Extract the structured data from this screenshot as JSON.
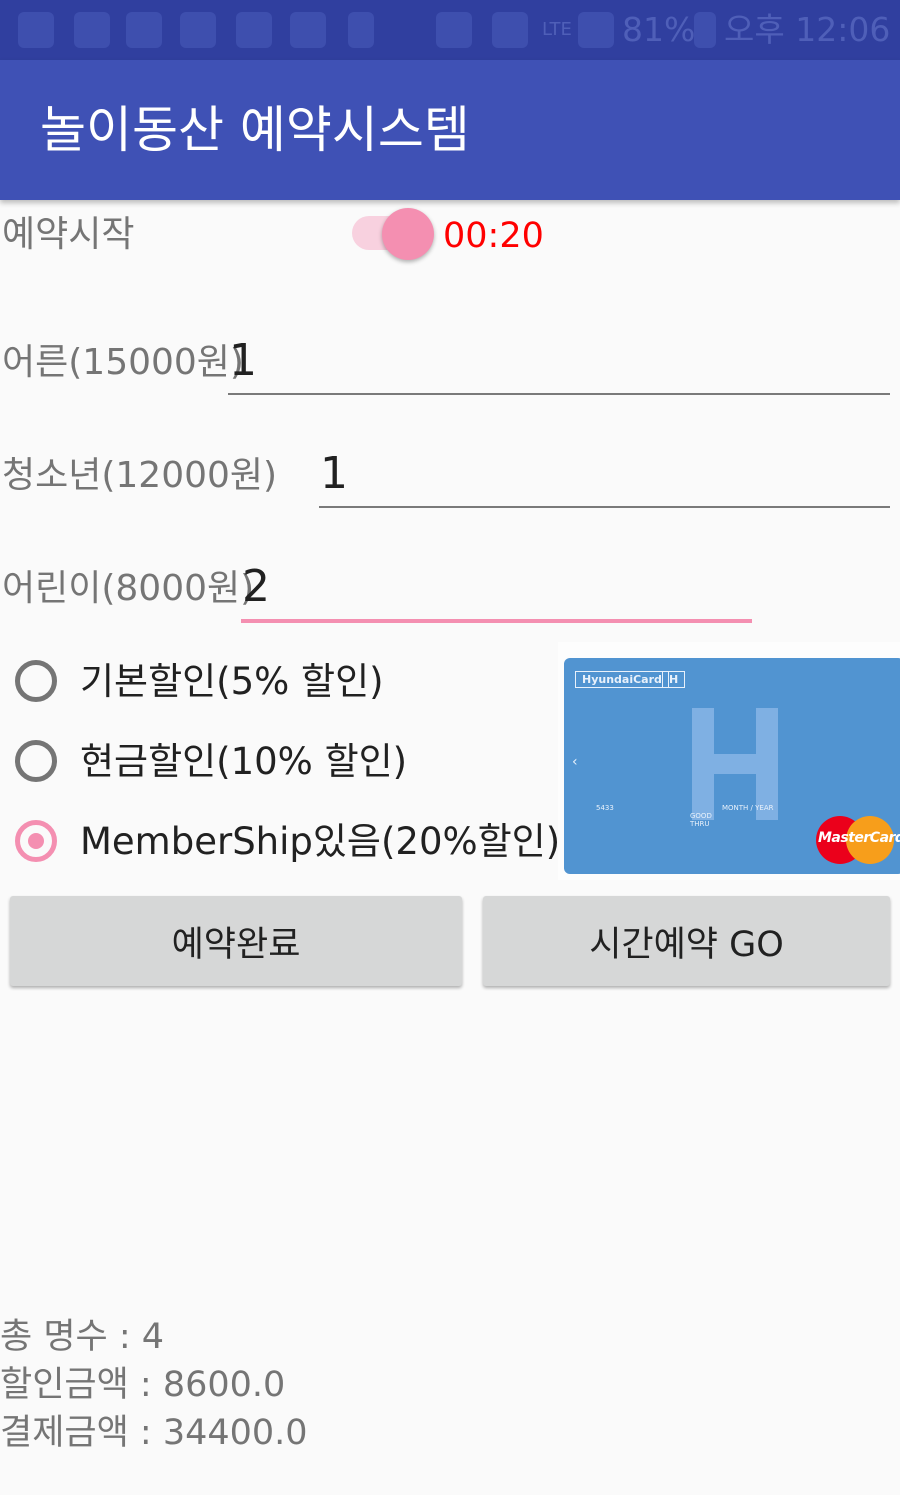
{
  "status_bar": {
    "battery": "81%",
    "time": "오후 12:06",
    "network": "LTE",
    "icons": [
      "chat-icon",
      "play-store-icon",
      "font-icon",
      "game-icon",
      "shield-icon",
      "call-icon",
      "usb-icon",
      "mute-icon",
      "alarm-icon",
      "signal-icon",
      "battery-icon"
    ]
  },
  "app_bar": {
    "title": "놀이동산 예약시스템"
  },
  "reservation": {
    "start_label": "예약시작",
    "switch_on": true,
    "timer": "00:20"
  },
  "fields": {
    "adult": {
      "label": "어른(15000원)",
      "value": "1"
    },
    "youth": {
      "label": "청소년(12000원)",
      "value": "1"
    },
    "child": {
      "label": "어린이(8000원)",
      "value": "2"
    }
  },
  "discounts": {
    "options": [
      {
        "label": "기본할인(5% 할인)",
        "checked": false
      },
      {
        "label": "현금할인(10% 할인)",
        "checked": false
      },
      {
        "label": "MemberShip있음(20%할인)",
        "checked": true
      }
    ]
  },
  "card": {
    "brand": "HyundaiCard",
    "brand_mark": "H",
    "number": "5433",
    "good_thru": "GOOD THRU",
    "month_year": "MONTH / YEAR",
    "network": "MasterCard",
    "accent": "#5194d1"
  },
  "buttons": {
    "complete": "예약완료",
    "time_reserve": "시간예약 GO"
  },
  "summary": {
    "total_people": "총 명수 : 4",
    "discount_amount": "할인금액 : 8600.0",
    "payment_amount": "결제금액 : 34400.0"
  },
  "colors": {
    "status_bar": "#303f9f",
    "app_bar": "#3f51b5",
    "accent": "#f48fb1",
    "timer": "#ff0000"
  }
}
